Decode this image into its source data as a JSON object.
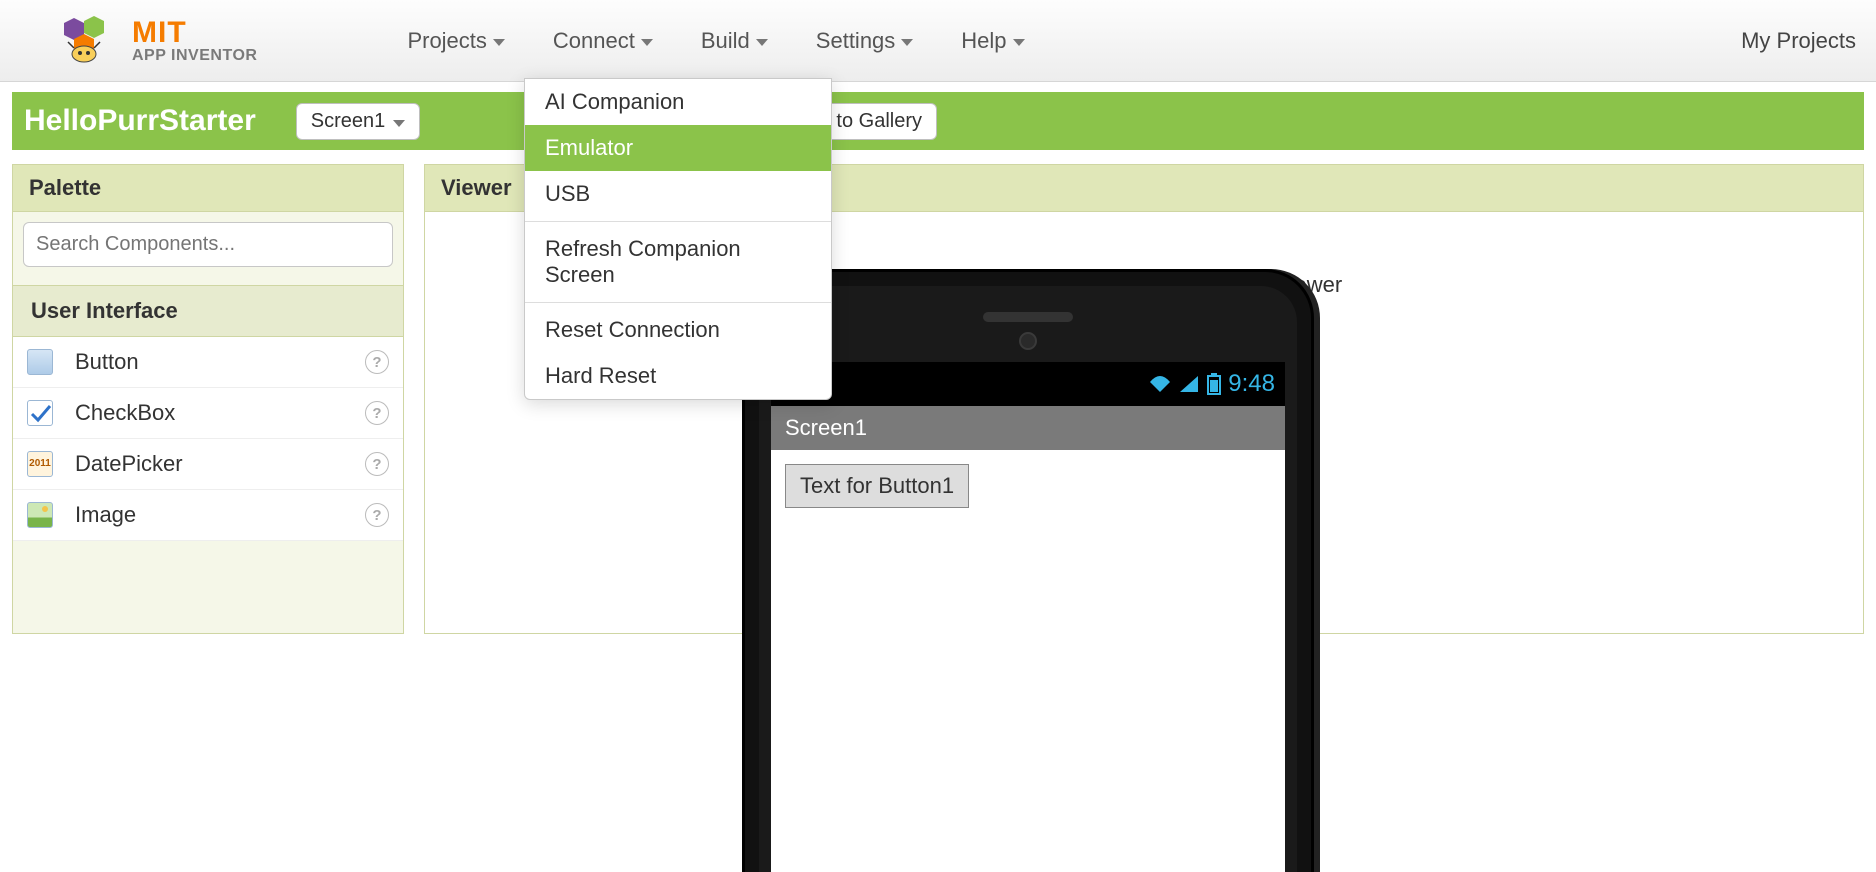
{
  "brand": {
    "mit": "MIT",
    "sub": "APP INVENTOR"
  },
  "menu": {
    "projects": "Projects",
    "connect": "Connect",
    "build": "Build",
    "settings": "Settings",
    "help": "Help"
  },
  "right_link": "My Projects",
  "project": {
    "title": "HelloPurrStarter",
    "screen_selector": "Screen1",
    "publish_btn": "Publish to Gallery"
  },
  "dropdown": {
    "items": [
      {
        "label": "AI Companion",
        "highlight": false
      },
      {
        "label": "Emulator",
        "highlight": true
      },
      {
        "label": "USB",
        "highlight": false
      }
    ],
    "sep1": true,
    "extra1": "Refresh Companion Screen",
    "sep2": true,
    "extra2": "Reset Connection",
    "extra3": "Hard Reset"
  },
  "palette": {
    "header": "Palette",
    "search_placeholder": "Search Components...",
    "section": "User Interface",
    "components": [
      {
        "label": "Button"
      },
      {
        "label": "CheckBox"
      },
      {
        "label": "DatePicker"
      },
      {
        "label": "Image"
      }
    ]
  },
  "viewer": {
    "header": "Viewer",
    "hidden_note": "hidden components in Viewer"
  },
  "phone": {
    "status_time": "9:48",
    "screen_title": "Screen1",
    "button_text": "Text for Button1"
  }
}
